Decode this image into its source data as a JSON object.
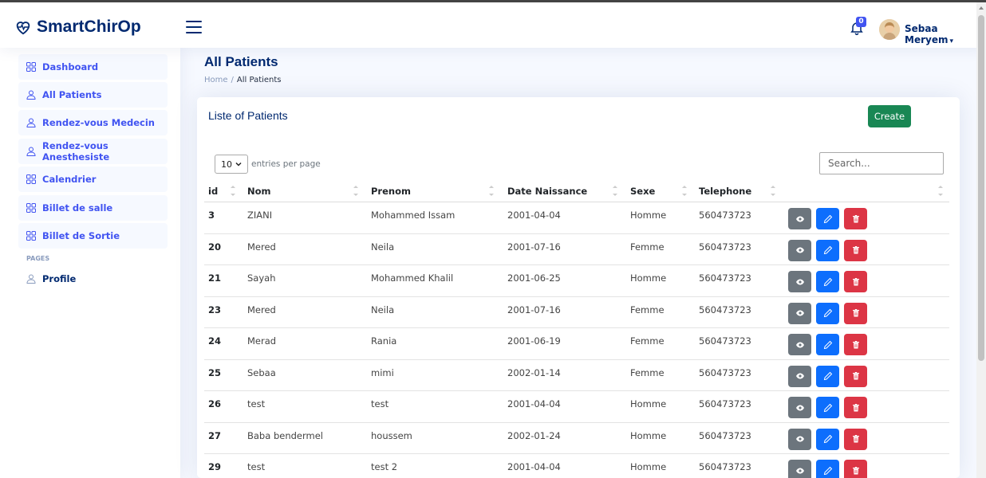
{
  "app": {
    "name": "SmartChirOp"
  },
  "header": {
    "notifications_count": "0",
    "user_name": "Sebaa Meryem",
    "caret": "▾"
  },
  "sidebar": {
    "items": [
      {
        "label": "Dashboard",
        "icon": "grid-icon"
      },
      {
        "label": "All Patients",
        "icon": "person-icon"
      },
      {
        "label": "Rendez-vous Medecin",
        "icon": "person-icon"
      },
      {
        "label": "Rendez-vous Anesthesiste",
        "icon": "person-icon"
      },
      {
        "label": "Calendrier",
        "icon": "grid-icon"
      },
      {
        "label": "Billet de salle",
        "icon": "grid-icon"
      },
      {
        "label": "Billet de Sortie",
        "icon": "grid-icon"
      }
    ],
    "heading": "PAGES",
    "profile_label": "Profile"
  },
  "page": {
    "title": "All Patients",
    "breadcrumb": {
      "home": "Home",
      "separator": "/",
      "current": "All Patients"
    }
  },
  "card": {
    "title": "Liste of Patients",
    "create_label": "Create",
    "entries_value": "10",
    "entries_label": "entries per page",
    "search_placeholder": "Search..."
  },
  "table": {
    "columns": [
      "id",
      "Nom",
      "Prenom",
      "Date Naissance",
      "Sexe",
      "Telephone"
    ],
    "rows": [
      {
        "id": "3",
        "nom": "ZIANI",
        "prenom": "Mohammed Issam",
        "date": "2001-04-04",
        "sexe": "Homme",
        "tel": "560473723"
      },
      {
        "id": "20",
        "nom": "Mered",
        "prenom": "Neila",
        "date": "2001-07-16",
        "sexe": "Femme",
        "tel": "560473723"
      },
      {
        "id": "21",
        "nom": "Sayah",
        "prenom": "Mohammed Khalil",
        "date": "2001-06-25",
        "sexe": "Homme",
        "tel": "560473723"
      },
      {
        "id": "23",
        "nom": "Mered",
        "prenom": "Neila",
        "date": "2001-07-16",
        "sexe": "Femme",
        "tel": "560473723"
      },
      {
        "id": "24",
        "nom": "Merad",
        "prenom": "Rania",
        "date": "2001-06-19",
        "sexe": "Femme",
        "tel": "560473723"
      },
      {
        "id": "25",
        "nom": "Sebaa",
        "prenom": "mimi",
        "date": "2002-01-14",
        "sexe": "Femme",
        "tel": "560473723"
      },
      {
        "id": "26",
        "nom": "test",
        "prenom": "test",
        "date": "2001-04-04",
        "sexe": "Homme",
        "tel": "560473723"
      },
      {
        "id": "27",
        "nom": "Baba bendermel",
        "prenom": "houssem",
        "date": "2002-01-24",
        "sexe": "Homme",
        "tel": "560473723"
      },
      {
        "id": "29",
        "nom": "test",
        "prenom": "test 2",
        "date": "2001-04-04",
        "sexe": "Homme",
        "tel": "560473723"
      }
    ]
  },
  "colors": {
    "primary": "#4154f1",
    "navy": "#012970",
    "create": "#198754",
    "view": "#6c757d",
    "edit": "#0d6efd",
    "delete": "#dc3545"
  }
}
